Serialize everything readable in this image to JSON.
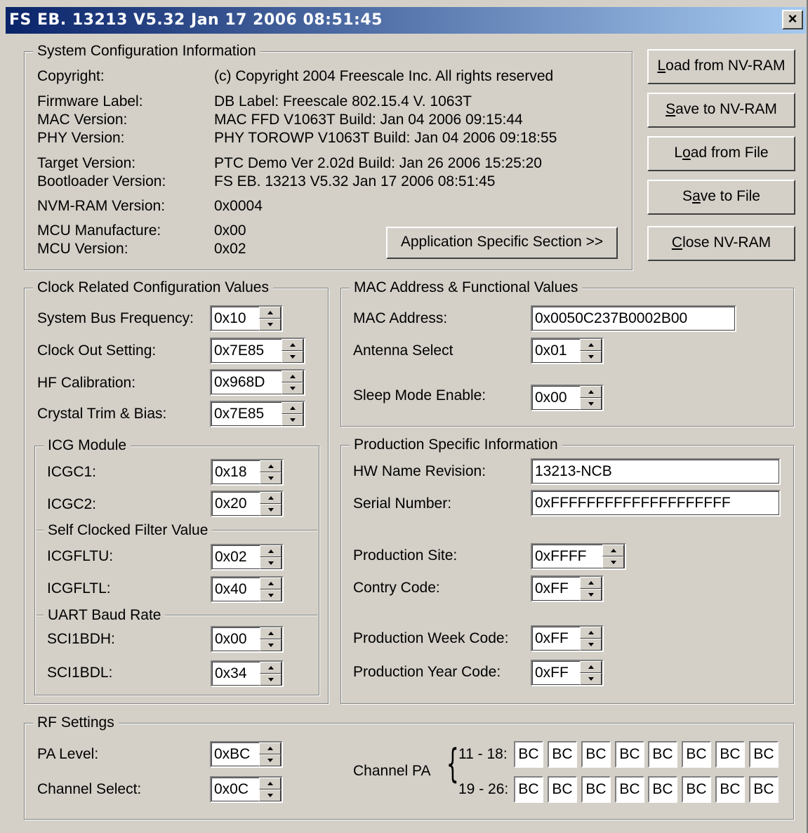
{
  "window": {
    "title": "FS EB. 13213  V5.32 Jan 17 2006 08:51:45",
    "close_label": "×"
  },
  "sysconf": {
    "legend": "System Configuration Information",
    "rows": [
      {
        "label": "Copyright:",
        "value": "(c) Copyright 2004 Freescale Inc. All rights reserved"
      },
      {
        "label": "Firmware Label:",
        "value": "DB Label: Freescale 802.15.4 V. 1063T"
      },
      {
        "label": "MAC Version:",
        "value": "MAC FFD    V1063T Build: Jan 04 2006 09:15:44"
      },
      {
        "label": "PHY Version:",
        "value": "PHY  TOROWP V1063T Build: Jan 04 2006 09:18:55"
      },
      {
        "label": "Target Version:",
        "value": "PTC Demo  Ver 2.02d Build: Jan 26 2006 15:25:20"
      },
      {
        "label": "Bootloader Version:",
        "value": "FS EB.  13213  V5.32 Jan 17 2006 08:51:45"
      },
      {
        "label": "NVM-RAM Version:",
        "value": "0x0004"
      },
      {
        "label": "MCU Manufacture:",
        "value": "0x00"
      },
      {
        "label": "MCU Version:",
        "value": "0x02"
      }
    ],
    "app_button": "Application Specific Section >>"
  },
  "side_buttons": [
    {
      "pre": "",
      "key": "L",
      "post": "oad from NV-RAM"
    },
    {
      "pre": "",
      "key": "S",
      "post": "ave to NV-RAM"
    },
    {
      "pre": "L",
      "key": "o",
      "post": "ad from File"
    },
    {
      "pre": "S",
      "key": "a",
      "post": "ve to File"
    },
    {
      "pre": "",
      "key": "C",
      "post": "lose NV-RAM"
    }
  ],
  "clock": {
    "legend": "Clock Related Configuration Values",
    "sys_bus": {
      "label": "System Bus Frequency:",
      "value": "0x10"
    },
    "clock_out": {
      "label": "Clock Out Setting:",
      "value": "0x7E85"
    },
    "hf_cal": {
      "label": "HF Calibration:",
      "value": "0x968D"
    },
    "crystal": {
      "label": "Crystal Trim & Bias:",
      "value": "0x7E85"
    },
    "icg_legend": "ICG Module",
    "icgc1": {
      "label": "ICGC1:",
      "value": "0x18"
    },
    "icgc2": {
      "label": "ICGC2:",
      "value": "0x20"
    },
    "scf_legend": "Self Clocked Filter Value",
    "icgfltu": {
      "label": "ICGFLTU:",
      "value": "0x02"
    },
    "icgfltl": {
      "label": "ICGFLTL:",
      "value": "0x40"
    },
    "uart_legend": "UART Baud Rate",
    "sci1bdh": {
      "label": "SCI1BDH:",
      "value": "0x00"
    },
    "sci1bdl": {
      "label": "SCI1BDL:",
      "value": "0x34"
    }
  },
  "mac": {
    "legend": "MAC Address & Functional Values",
    "address": {
      "label": "MAC Address:",
      "value": "0x0050C237B0002B00"
    },
    "antenna": {
      "label": "Antenna Select",
      "value": "0x01"
    },
    "sleep": {
      "label": "Sleep Mode Enable:",
      "value": "0x00"
    }
  },
  "prod": {
    "legend": "Production Specific Information",
    "hw_name": {
      "label": "HW Name Revision:",
      "value": "13213-NCB"
    },
    "serial": {
      "label": "Serial Number:",
      "value": "0xFFFFFFFFFFFFFFFFFFFF"
    },
    "site": {
      "label": "Production Site:",
      "value": "0xFFFF"
    },
    "country": {
      "label": "Contry Code:",
      "value": "0xFF"
    },
    "week": {
      "label": "Production Week Code:",
      "value": "0xFF"
    },
    "year": {
      "label": "Production Year Code:",
      "value": "0xFF"
    }
  },
  "rf": {
    "legend": "RF Settings",
    "pa_level": {
      "label": "PA Level:",
      "value": "0xBC"
    },
    "channel": {
      "label": "Channel Select:",
      "value": "0x0C"
    },
    "channel_pa_label": "Channel PA",
    "row1_label": "11 - 18:",
    "row2_label": "19 - 26:",
    "row1": [
      "BC",
      "BC",
      "BC",
      "BC",
      "BC",
      "BC",
      "BC",
      "BC"
    ],
    "row2": [
      "BC",
      "BC",
      "BC",
      "BC",
      "BC",
      "BC",
      "BC",
      "BC"
    ]
  }
}
